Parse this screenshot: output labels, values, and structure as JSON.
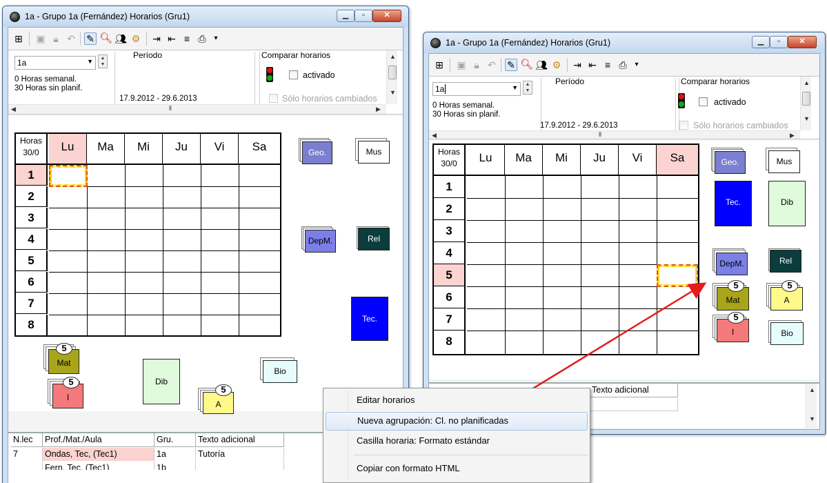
{
  "window1": {
    "title": "1a - Grupo 1a (Fernández) Horarios (Gru1)",
    "combo_value": "1a",
    "hours_week": "0 Horas semanal.",
    "hours_unplanned": "30 Horas sin planif.",
    "period_label": "Período",
    "period_dates": "17.9.2012 - 29.6.2013",
    "compare_label": "Comparar horarios",
    "activated_label": "activado",
    "only_changed_label": "Sólo horarios cambiados",
    "grid_header_top": "Horas",
    "grid_header_bottom": "30/0",
    "days": [
      "Lu",
      "Ma",
      "Mi",
      "Ju",
      "Vi",
      "Sa"
    ],
    "hours": [
      "1",
      "2",
      "3",
      "4",
      "5",
      "6",
      "7",
      "8"
    ],
    "lessons": {
      "geo": "Geo.",
      "mus": "Mus",
      "depm": "DepM.",
      "rel": "Rel",
      "tec": "Tec.",
      "mat": "Mat",
      "mat_count": "5",
      "i": "I",
      "i_count": "5",
      "dib": "Dib",
      "bio": "Bio",
      "a": "A",
      "a_count": "5"
    },
    "table": {
      "headers": [
        "N.lec",
        "Prof./Mat./Aula",
        "Gru.",
        "Texto adicional"
      ],
      "rows": [
        [
          "7",
          "Ondas, Tec, (Tec1)",
          "1a",
          "Tutoría"
        ],
        [
          "",
          "Fern, Tec, (Tec1)",
          "1b",
          ""
        ]
      ]
    }
  },
  "window2": {
    "title": "1a - Grupo 1a (Fernández) Horarios (Gru1)",
    "combo_value": "1a",
    "hours_week": "0 Horas semanal.",
    "hours_unplanned": "30 Horas sin planif.",
    "period_label": "Período",
    "period_dates": "17.9.2012 - 29.6.2013",
    "compare_label": "Comparar horarios",
    "activated_label": "activado",
    "only_changed_label": "Sólo horarios cambiados",
    "grid_header_top": "Horas",
    "grid_header_bottom": "30/0",
    "days": [
      "Lu",
      "Ma",
      "Mi",
      "Ju",
      "Vi",
      "Sa"
    ],
    "hours": [
      "1",
      "2",
      "3",
      "4",
      "5",
      "6",
      "7",
      "8"
    ],
    "lessons": {
      "geo": "Geo.",
      "mus": "Mus",
      "tec": "Tec.",
      "dib": "Dib",
      "depm": "DepM.",
      "rel": "Rel",
      "mat": "Mat",
      "mat_count": "5",
      "a": "A",
      "a_count": "5",
      "i": "I",
      "i_count": "5",
      "bio": "Bio"
    },
    "table": {
      "extra_header": "Texto adicional"
    }
  },
  "context_menu": {
    "items": [
      "Editar horarios",
      "Nueva agrupación: Cl. no planificadas",
      "Casilla horaria: Formato estándar",
      "Copiar con formato HTML"
    ]
  },
  "colors": {
    "geo": "#7b7fcf",
    "depm": "#7b7fe6",
    "rel": "#0b3d3d",
    "tec": "#0000ff",
    "mat": "#a9a51a",
    "i": "#f4797a",
    "dib": "#dffbdb",
    "bio": "#e7fdfd",
    "a": "#fff98a",
    "highlight": "#fbd3d0",
    "arrow": "#e31b1b"
  },
  "icons": [
    "globe-icon",
    "minimize-icon",
    "maximize-icon",
    "close-icon",
    "traffic-light-icon",
    "magnifier-icon",
    "gear-icon",
    "pencil-icon"
  ]
}
